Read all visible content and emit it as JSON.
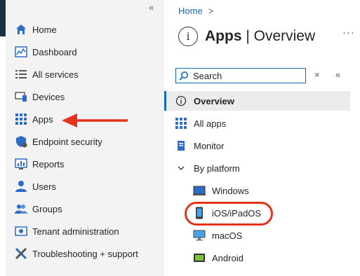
{
  "nav": {
    "collapse_glyph": "«",
    "items": [
      {
        "label": "Home",
        "icon": "home-icon"
      },
      {
        "label": "Dashboard",
        "icon": "dashboard-icon"
      },
      {
        "label": "All services",
        "icon": "list-icon"
      },
      {
        "label": "Devices",
        "icon": "devices-icon"
      },
      {
        "label": "Apps",
        "icon": "apps-grid-icon"
      },
      {
        "label": "Endpoint security",
        "icon": "shield-icon"
      },
      {
        "label": "Reports",
        "icon": "reports-icon"
      },
      {
        "label": "Users",
        "icon": "user-icon"
      },
      {
        "label": "Groups",
        "icon": "groups-icon"
      },
      {
        "label": "Tenant administration",
        "icon": "tenant-admin-icon"
      },
      {
        "label": "Troubleshooting + support",
        "icon": "wrench-icon"
      }
    ]
  },
  "blade": {
    "breadcrumb": {
      "home": "Home",
      "sep": ">"
    },
    "title_main": "Apps",
    "title_sub": " | Overview",
    "more": "···",
    "search": {
      "placeholder": "Search",
      "clear": "×",
      "collapse": "«"
    },
    "menu": [
      {
        "label": "Overview",
        "icon": "info-icon",
        "selected": true
      },
      {
        "label": "All apps",
        "icon": "apps-grid-icon"
      },
      {
        "label": "Monitor",
        "icon": "monitor-book-icon"
      },
      {
        "label": "By platform",
        "icon": "chevron-down-icon"
      },
      {
        "label": "Windows",
        "icon": "windows-device-icon"
      },
      {
        "label": "iOS/iPadOS",
        "icon": "phone-icon"
      },
      {
        "label": "macOS",
        "icon": "desktop-icon"
      },
      {
        "label": "Android",
        "icon": "android-device-icon"
      }
    ]
  },
  "colors": {
    "accent": "#0f6cbd",
    "annotation": "#e5321d",
    "nav_bg": "#f3f3f3"
  }
}
